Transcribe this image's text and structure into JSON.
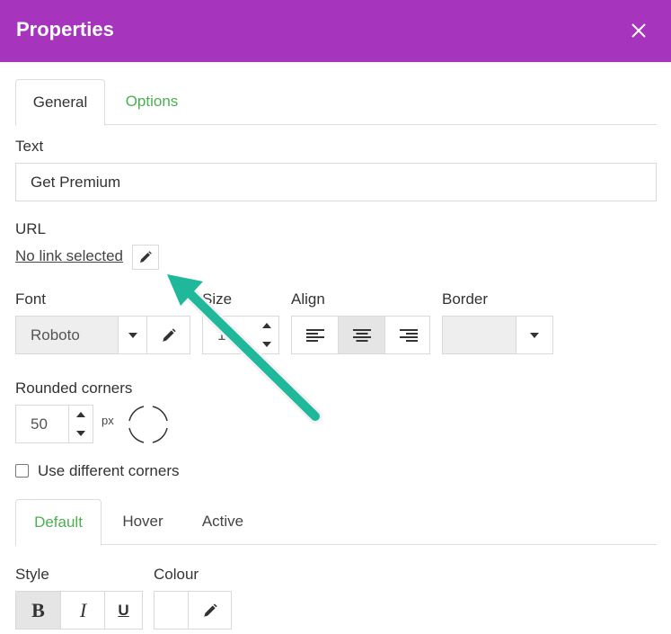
{
  "dialog": {
    "title": "Properties",
    "close_icon": "close-icon"
  },
  "tabs": [
    {
      "label": "General",
      "active": true
    },
    {
      "label": "Options",
      "active": false
    }
  ],
  "text_field": {
    "label": "Text",
    "value": "Get Premium"
  },
  "url": {
    "label": "URL",
    "link_text": "No link selected",
    "edit_icon": "pencil-icon"
  },
  "font": {
    "label": "Font",
    "value": "Roboto"
  },
  "size": {
    "label": "Size",
    "value": "14"
  },
  "align": {
    "label": "Align",
    "options": [
      "align-left",
      "align-center",
      "align-right"
    ],
    "selected": "align-center"
  },
  "border": {
    "label": "Border"
  },
  "rounded_corners": {
    "label": "Rounded corners",
    "value": "50",
    "unit": "px"
  },
  "different_corners": {
    "label": "Use different corners",
    "checked": false
  },
  "state_tabs": [
    {
      "label": "Default",
      "active": true
    },
    {
      "label": "Hover",
      "active": false
    },
    {
      "label": "Active",
      "active": false
    }
  ],
  "style": {
    "label": "Style",
    "bold": "B",
    "italic": "I",
    "underline": "U",
    "selected": "bold"
  },
  "colour": {
    "label": "Colour"
  },
  "colors": {
    "header": "#a634bd",
    "accent_green": "#4caf50",
    "annotation_arrow": "#1fb89a"
  }
}
